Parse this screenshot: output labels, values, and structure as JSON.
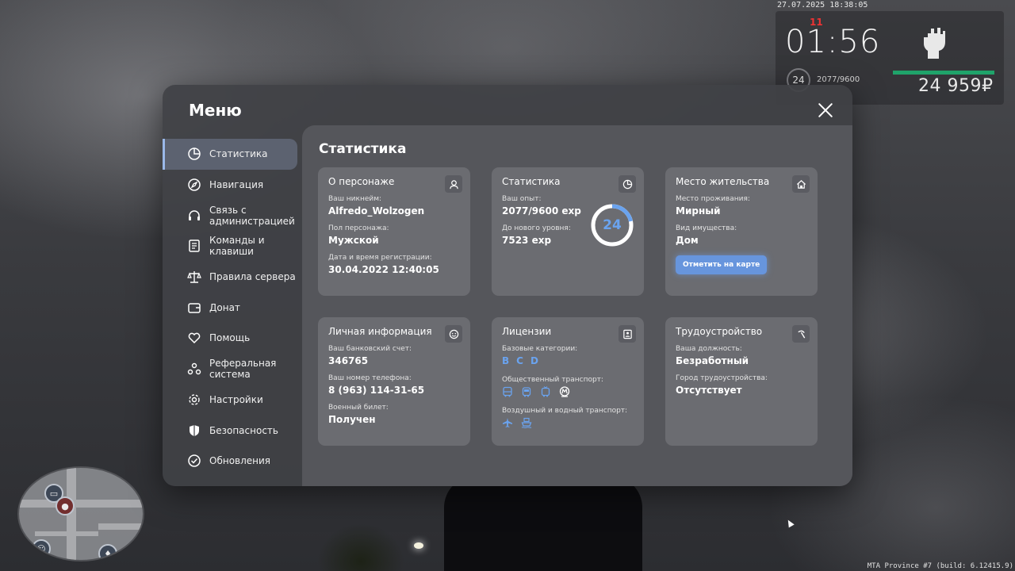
{
  "hud": {
    "datetime": "27.07.2025 18:38:05",
    "clock": "01:56",
    "clock_mark": "11",
    "level": "24",
    "exp": "2077/9600",
    "health_fraction": 1.0,
    "money": "24 959₽",
    "health_color": "#1fa36a"
  },
  "watermark": "MTA Province #7 (build: 6.12415.9)",
  "menu": {
    "title": "Меню",
    "close_icon": "close-icon",
    "sidebar": [
      {
        "label": "Статистика",
        "icon": "pie-chart-icon",
        "active": true
      },
      {
        "label": "Навигация",
        "icon": "compass-icon"
      },
      {
        "label": "Связь с администрацией",
        "icon": "headset-icon"
      },
      {
        "label": "Команды и клавиши",
        "icon": "document-icon"
      },
      {
        "label": "Правила сервера",
        "icon": "scales-icon"
      },
      {
        "label": "Донат",
        "icon": "wallet-icon"
      },
      {
        "label": "Помощь",
        "icon": "heart-hands-icon"
      },
      {
        "label": "Реферальная система",
        "icon": "referral-icon"
      },
      {
        "label": "Настройки",
        "icon": "gear-icon"
      },
      {
        "label": "Безопасность",
        "icon": "shield-icon"
      },
      {
        "label": "Обновления",
        "icon": "check-circle-icon"
      }
    ],
    "content_title": "Статистика",
    "cards": {
      "character": {
        "title": "О персонаже",
        "nickname_label": "Ваш никнейм:",
        "nickname": "Alfredo_Wolzogen",
        "gender_label": "Пол персонажа:",
        "gender": "Мужской",
        "reg_label": "Дата и время регистрации:",
        "reg_date": "30.04.2022 12:40:05"
      },
      "stats": {
        "title": "Статистика",
        "exp_label": "Ваш опыт:",
        "exp": "2077/9600 exp",
        "next_label": "До нового уровня:",
        "next": "7523 exp",
        "level": "24",
        "progress": 0.2164,
        "accent": "#6aa3ef"
      },
      "residence": {
        "title": "Место жительства",
        "place_label": "Место проживания:",
        "place": "Мирный",
        "property_label": "Вид имущества:",
        "property": "Дом",
        "button": "Отметить на карте"
      },
      "personal": {
        "title": "Личная информация",
        "bank_label": "Ваш банковский счет:",
        "bank": "346765",
        "phone_label": "Ваш номер телефона:",
        "phone": "8 (963) 114-31-65",
        "military_label": "Военный билет:",
        "military": "Получен"
      },
      "licenses": {
        "title": "Лицензии",
        "base_label": "Базовые категории:",
        "categories": [
          "B",
          "C",
          "D"
        ],
        "public_label": "Общественный транспорт:",
        "public_icons": [
          "bus-icon",
          "tram-icon",
          "trolleybus-icon",
          "metro-icon"
        ],
        "air_label": "Воздушный и водный транспорт:",
        "air_icons": [
          "plane-icon",
          "ship-icon"
        ]
      },
      "employment": {
        "title": "Трудоустройство",
        "position_label": "Ваша должность:",
        "position": "Безработный",
        "city_label": "Город трудоустройства:",
        "city": "Отсутствует"
      }
    }
  }
}
